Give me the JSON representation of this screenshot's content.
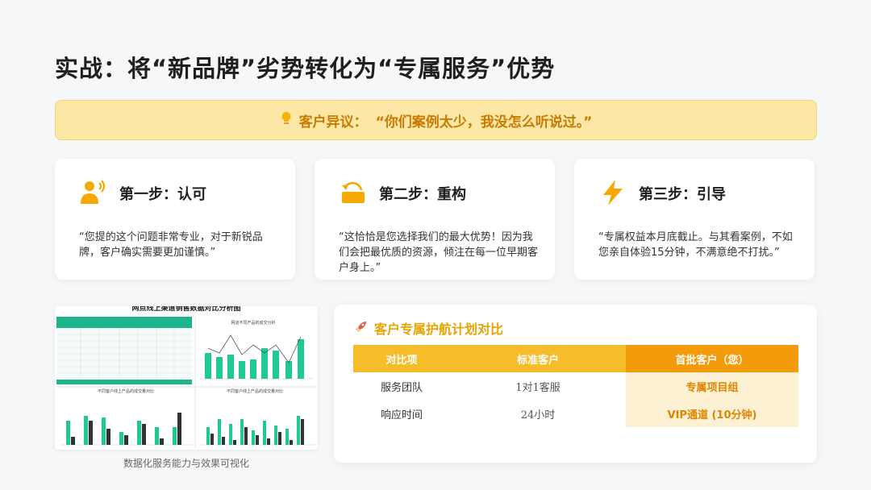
{
  "title": "实战：将“新品牌”劣势转化为“专属服务”优势",
  "objection": {
    "label": "客户异议：",
    "quote": "“你们案例太少，我没怎么听说过。”",
    "icon": "lightbulb-icon"
  },
  "steps": [
    {
      "title": "第一步：认可",
      "icon": "speaking-person-icon",
      "quote": "“您提的这个问题非常专业，对于新锐品牌，客户确实需要更加谨慎。”"
    },
    {
      "title": "第二步：重构",
      "icon": "reframe-arrow-icon",
      "quote": "“这恰恰是您选择我们的最大优势！因为我们会把最优质的资源，倾注在每一位早期客户身上。”"
    },
    {
      "title": "第三步：引导",
      "icon": "lightning-icon",
      "quote": "“专属权益本月底截止。与其看案例，不如您亲自体验15分钟，不满意绝不打扰。”"
    }
  ],
  "dashboard": {
    "caption": "数据化服务能力与效果可视化",
    "header": "网点线上渠道销售数据对比分析图",
    "panel2_title": "网店不同产品的成交分析",
    "panel3_title": "不同客户线上产品的成交量对比",
    "panel4_title": "不同客户线上产品的成交量对比"
  },
  "compare": {
    "title": "客户专属护航计划对比",
    "headers": [
      "对比项",
      "标准客户",
      "首批客户（您）"
    ],
    "rows": [
      [
        "服务团队",
        "1对1客服",
        "专属项目组"
      ],
      [
        "响应时间",
        "24小时",
        "VIP通道 (10分钟)"
      ]
    ]
  },
  "colors": {
    "accent": "#f6bd2b",
    "accent_dark": "#f49b0c",
    "highlight_bg": "#fdf1d3",
    "chart_green": "#1fc894",
    "chart_dark": "#333333"
  }
}
